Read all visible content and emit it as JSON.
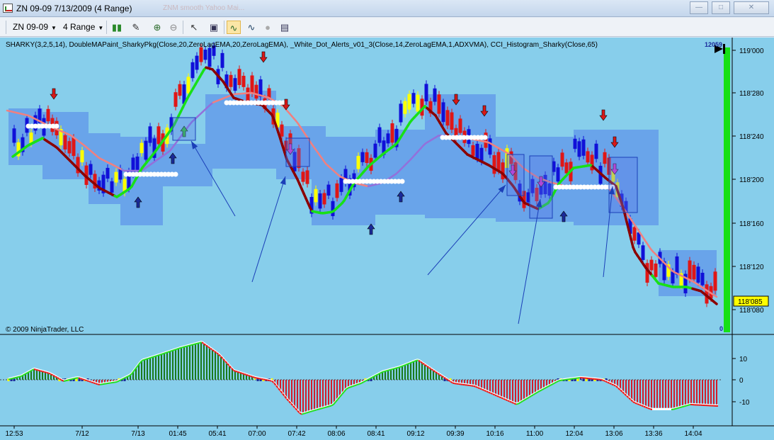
{
  "window": {
    "title": "ZN 09-09  7/13/2009 (4 Range)",
    "ghost_text": "ZNM smooth Yahoo Mai...",
    "buttons": [
      "minimize",
      "maximize",
      "close"
    ]
  },
  "toolbar": {
    "instrument": "ZN 09-09",
    "period": "4 Range",
    "icons": [
      "chart-style-icon",
      "draw-pen-icon",
      "zoom-in-icon",
      "zoom-out-icon",
      "pointer-icon",
      "data-box-icon",
      "strategies-icon",
      "indicators-icon",
      "globe-icon",
      "properties-icon"
    ]
  },
  "indicator_label": "SHARKY(3,2,5,14), DoubleMAPaint_SharkyPkg(Close,20,ZeroLagEMA,20,ZeroLagEMA), _White_Dot_Alerts_v01_3(Close,14,ZeroLagEMA,1,ADXVMA), CCI_Histogram_Sharky(Close,65)",
  "copyright": "© 2009 NinjaTrader, LLC",
  "corner_counter": "12059",
  "zero_label": "0",
  "price_axis": {
    "labels": [
      "119'000",
      "118'280",
      "118'240",
      "118'200",
      "118'160",
      "118'120",
      "118'080"
    ],
    "last_price": "118'085"
  },
  "cci_axis": {
    "labels": [
      "10",
      "0",
      "-10"
    ]
  },
  "time_axis": {
    "labels": [
      "12:53",
      "7/12",
      "7/13",
      "01:45",
      "05:41",
      "07:00",
      "07:42",
      "08:06",
      "08:41",
      "09:12",
      "09:39",
      "10:16",
      "11:00",
      "12:04",
      "13:06",
      "13:36",
      "14:04"
    ]
  },
  "colors": {
    "chart_bg": "#87ceeb",
    "band": "#5f95ea",
    "bull_bar": "#1010d8",
    "bear_bar": "#e01616",
    "neutral_bar": "#ffff00",
    "ma_up": "#18e018",
    "ma_down": "#8b0000",
    "slow_ma_down": "#f08080",
    "slow_ma_up": "#9370db",
    "hist_green": "#1b7a1b",
    "hist_red": "#d21c2a",
    "annotation": "#1b3fb8"
  }
}
